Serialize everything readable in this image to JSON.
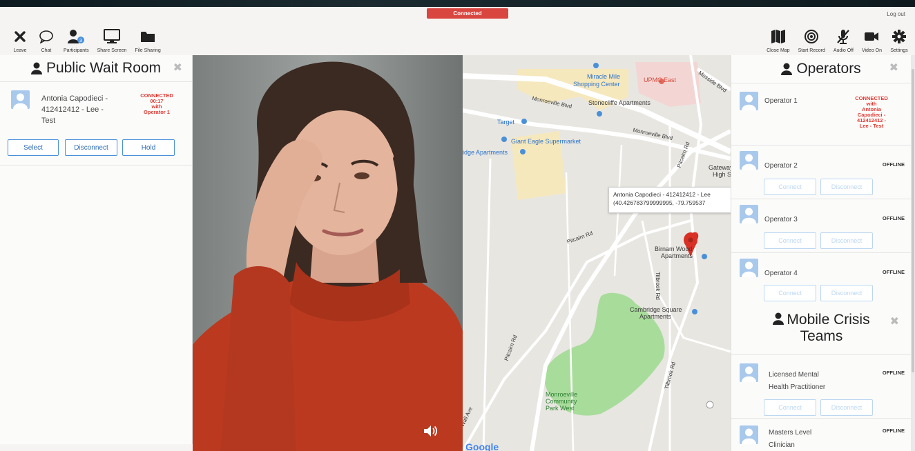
{
  "status": {
    "label": "Connected"
  },
  "header": {
    "logout_label": "Log out"
  },
  "toolbar_left": [
    {
      "icon": "close-icon",
      "label": "Leave"
    },
    {
      "icon": "chat-icon",
      "label": "Chat"
    },
    {
      "icon": "participants-icon",
      "label": "Participants",
      "badge": "3"
    },
    {
      "icon": "monitor-icon",
      "label": "Share Screen"
    },
    {
      "icon": "folder-icon",
      "label": "File Sharing"
    }
  ],
  "toolbar_right": [
    {
      "icon": "map-icon",
      "label": "Close Map"
    },
    {
      "icon": "record-icon",
      "label": "Start Record"
    },
    {
      "icon": "mic-off-icon",
      "label": "Audio Off"
    },
    {
      "icon": "video-camera-icon",
      "label": "Video On"
    },
    {
      "icon": "gear-icon",
      "label": "Settings"
    }
  ],
  "wait_room": {
    "title": "Public Wait Room",
    "entry": {
      "name": "Antonia Capodieci - 412412412 - Lee - Test",
      "status_lines": [
        "CONNECTED",
        "00:17",
        "with",
        "Operator 1"
      ],
      "buttons": {
        "select": "Select",
        "disconnect": "Disconnect",
        "hold": "Hold"
      }
    }
  },
  "map": {
    "labels": {
      "miracle": "Miracle Mile",
      "shopping": "Shopping Center",
      "upmc": "UPMC East",
      "stonecliffe": "Stonecliffe Apartments",
      "monroeville_blvd": "Monroeville Blvd",
      "monroeville_blvd2": "Monroeville Blvd",
      "target": "Target",
      "giant_eagle": "Giant Eagle Supermarket",
      "bridge_apts": "idge Apartments",
      "gateway": "Gateway",
      "high": "High S",
      "pitcairn_rd": "Pitcairn Rd",
      "pitcairn_rd2": "Pitcairn Rd",
      "pitcairn_rd3": "Pitcairn Rd",
      "birnam": "Birnam Wood",
      "birnam2": "Apartments",
      "tilbrook": "Tilbrook Rd",
      "tilbrook2": "Tilbrook Rd",
      "cambridge": "Cambridge Square",
      "cambridge2": "Apartments",
      "park1": "Monroeville",
      "park2": "Community",
      "park3": "Park West",
      "wall_ave": "Wall Ave",
      "mosside": "Mosside Blvd"
    },
    "callout": {
      "line1": "Antonia Capodieci - 412412412 - Lee",
      "line2": "(40.426783799999995, -79.759537"
    },
    "google": "Google"
  },
  "operators": {
    "title": "Operators",
    "list": [
      {
        "name": "Operator 1",
        "status_lines": [
          "CONNECTED",
          "with",
          "Antonia",
          "Capodieci -",
          "412412412 -",
          "Lee - Test"
        ]
      },
      {
        "name": "Operator 2",
        "status": "OFFLINE"
      },
      {
        "name": "Operator 3",
        "status": "OFFLINE"
      },
      {
        "name": "Operator 4",
        "status": "OFFLINE"
      }
    ],
    "connect_label": "Connect",
    "disconnect_label": "Disconnect"
  },
  "mobile_crisis": {
    "title_line1": "Mobile Crisis",
    "title_line2": "Teams",
    "list": [
      {
        "name_line1": "Licensed Mental",
        "name_line2": "Health Practitioner",
        "status": "OFFLINE"
      },
      {
        "name_line1": "Masters Level",
        "name_line2": "Clinician",
        "status": "OFFLINE"
      }
    ]
  }
}
